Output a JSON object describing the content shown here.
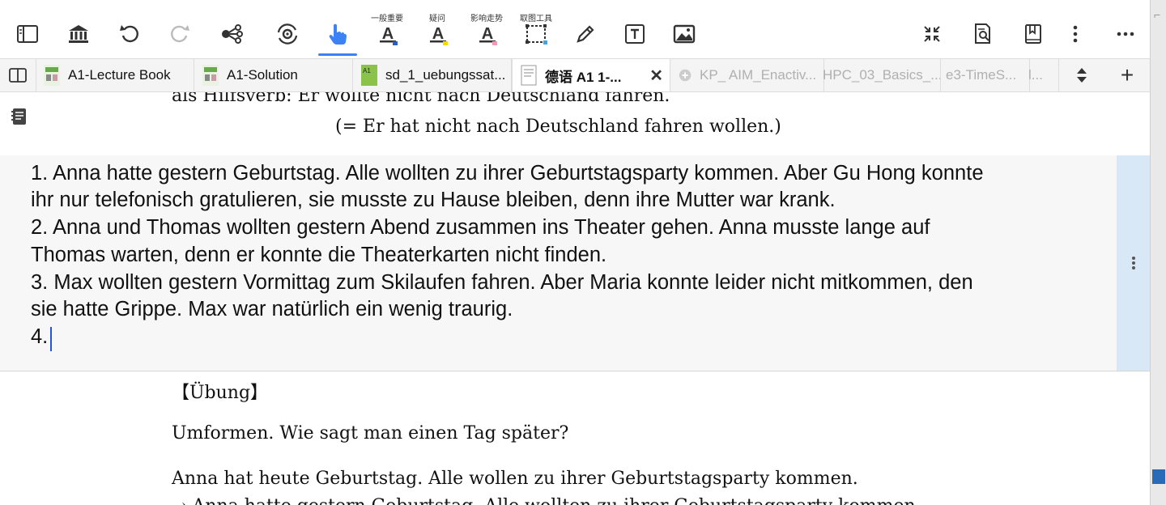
{
  "toolbar": {
    "label_general": "一般重要",
    "label_question": "疑问",
    "label_trend": "影响走势",
    "label_capture": "取图工具"
  },
  "tabs": [
    {
      "label": "A1-Lecture Book"
    },
    {
      "label": "A1-Solution"
    },
    {
      "label": "sd_1_uebungssat..."
    },
    {
      "label": "德语 A1 1-...",
      "active": true
    },
    {
      "label": "KP_ AIM_Enactiv..."
    },
    {
      "label": "HPC_03_Basics_..."
    },
    {
      "label": "e3-TimeS..."
    },
    {
      "label": "l..."
    }
  ],
  "document": {
    "top_line1": "als Hilfsverb:  Er wollte nicht nach Deutschland fahren.",
    "top_line2": "(= Er hat nicht nach Deutschland fahren wollen.)",
    "editor_lines": [
      "1. Anna hatte gestern Geburtstag. Alle wollten zu ihrer Geburtstagsparty kommen. Aber Gu Hong konnte",
      "ihr nur telefonisch gratulieren, sie musste zu Hause bleiben, denn ihre Mutter war krank.",
      "2. Anna und Thomas wollten gestern Abend zusammen ins Theater gehen. Anna musste lange auf",
      "Thomas warten, denn er konnte die Theaterkarten nicht finden.",
      "3. Max wollten gestern Vormittag zum Skilaufen fahren. Aber Maria konnte leider nicht mitkommen, den",
      "sie hatte Grippe. Max war natürlich ein  wenig traurig.",
      "4."
    ],
    "uebung_heading": "【Übung】",
    "uebung_instruction": "Umformen. Wie sagt man einen Tag später?",
    "uebung_example": "Anna hat heute Geburtstag. Alle wollen zu ihrer Geburtstagsparty kommen.",
    "uebung_cut": "→ Anna hatte gestern Geburtstag. Alle wollten zu ihrer Geburtstagsparty kommen."
  },
  "colors": {
    "accent": "#3b82f6",
    "editor_side": "#d8e8f6",
    "highlight_yellow": "#f5d90a",
    "highlight_pink": "#f29ab5",
    "capture_blue": "#3ba7f2"
  }
}
